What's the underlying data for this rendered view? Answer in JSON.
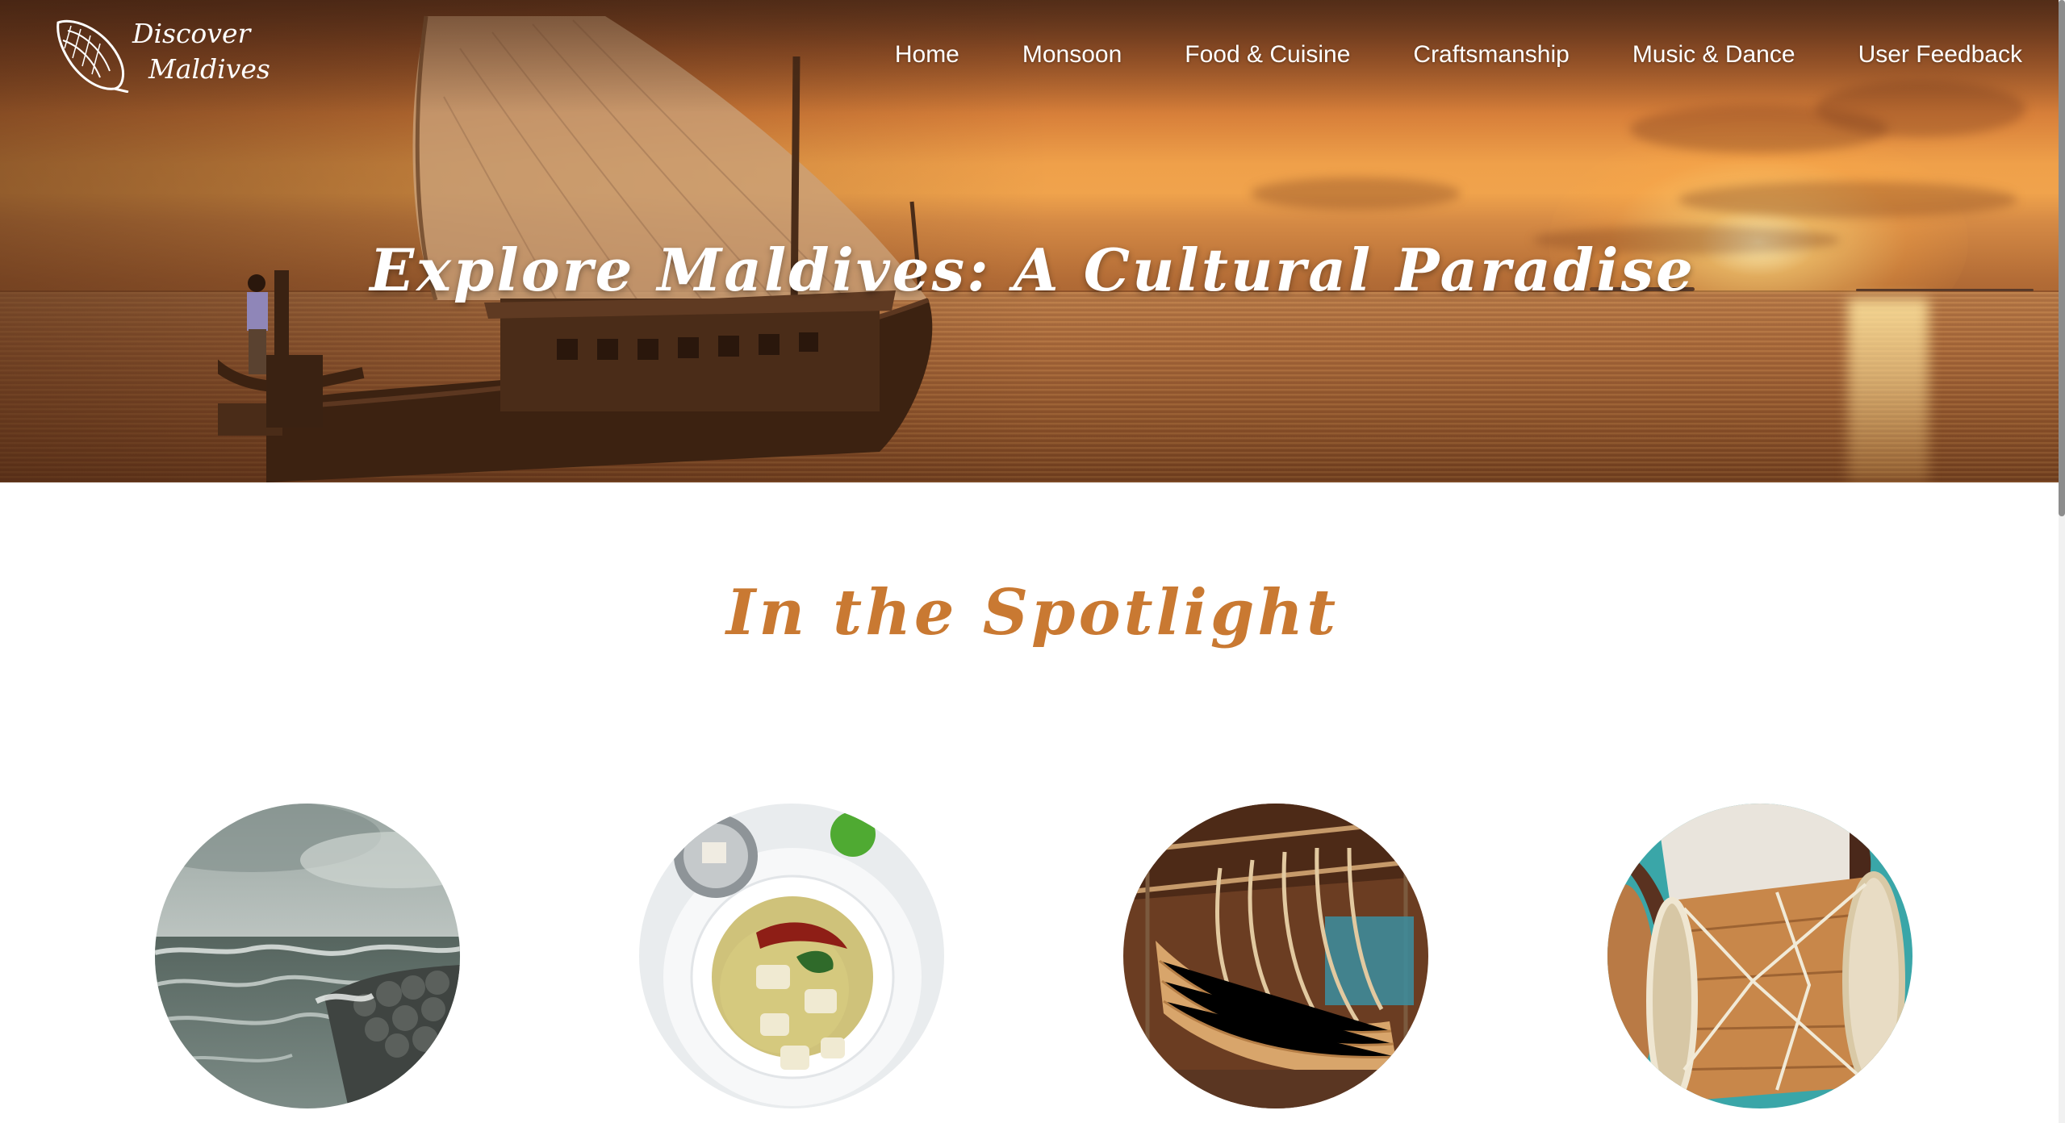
{
  "brand": {
    "logo_line1": "Discover",
    "logo_line2": "Maldives",
    "logo_icon": "conch-shell-icon"
  },
  "nav": {
    "items": [
      {
        "label": "Home"
      },
      {
        "label": "Monsoon"
      },
      {
        "label": "Food & Cuisine"
      },
      {
        "label": "Craftsmanship"
      },
      {
        "label": "Music & Dance"
      },
      {
        "label": "User Feedback"
      }
    ]
  },
  "hero": {
    "title": "Explore Maldives: A Cultural Paradise"
  },
  "spotlight": {
    "title": "In the Spotlight",
    "cards": [
      {
        "image": "stormy-sea-image"
      },
      {
        "image": "fish-soup-image"
      },
      {
        "image": "boat-building-image"
      },
      {
        "image": "bodu-beru-drum-image"
      }
    ]
  },
  "colors": {
    "accent": "#c97932",
    "nav_text": "#ffffff",
    "background": "#ffffff"
  }
}
